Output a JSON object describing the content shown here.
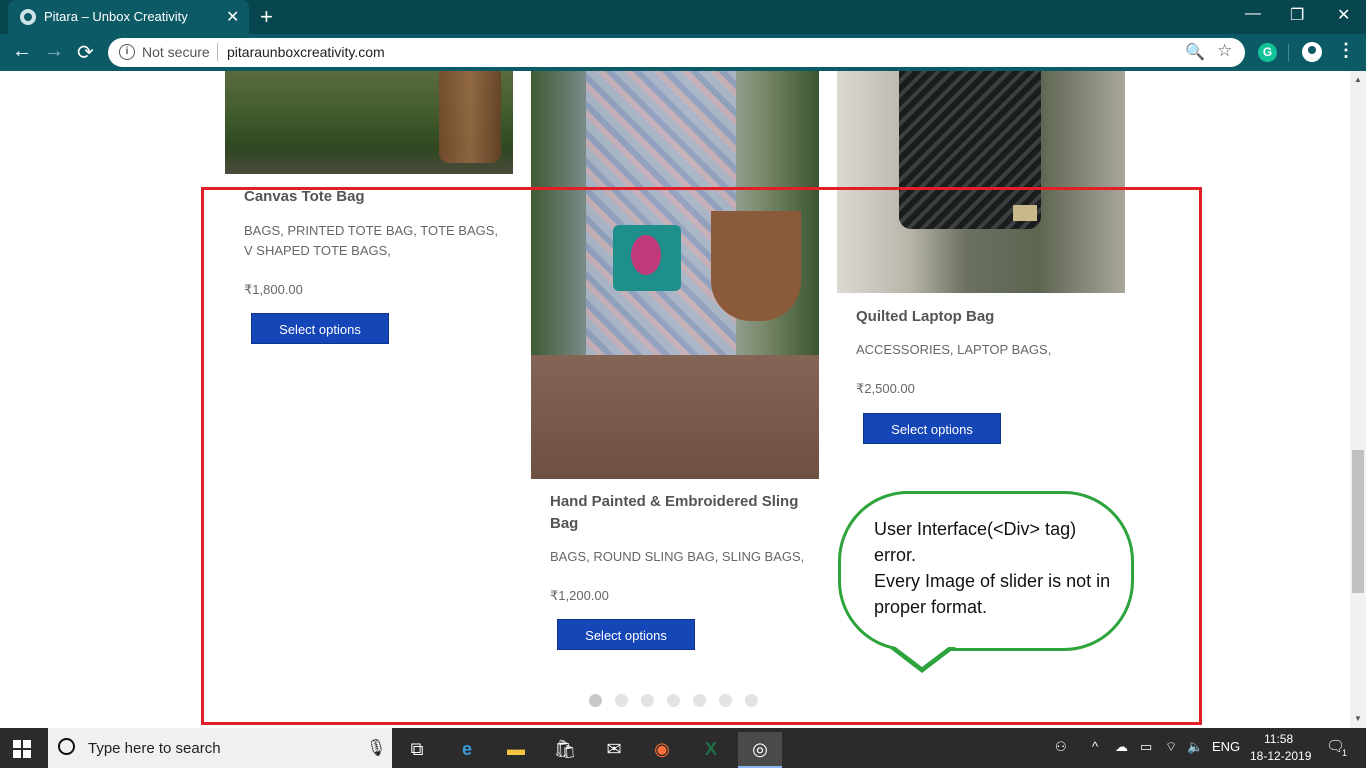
{
  "browser": {
    "tab_title": "Pitara – Unbox Creativity",
    "tab_close": "✕",
    "new_tab": "+",
    "window_controls": {
      "minimize": "—",
      "restore": "❐",
      "close": "✕"
    },
    "nav": {
      "back": "←",
      "forward": "→",
      "reload": "⟳"
    },
    "security_label": "Not secure",
    "url": "pitaraunboxcreativity.com",
    "icons": {
      "zoom": "🔍",
      "star": "☆",
      "extension_letter": "G",
      "menu": "⋮"
    }
  },
  "products": [
    {
      "title": "Canvas Tote Bag",
      "categories": "BAGS, PRINTED TOTE BAG, TOTE BAGS, V SHAPED TOTE BAGS,",
      "price": "₹1,800.00",
      "button": "Select options"
    },
    {
      "title": "Hand Painted & Embroidered Sling Bag",
      "categories": "BAGS, ROUND SLING BAG, SLING BAGS,",
      "price": "₹1,200.00",
      "button": "Select options"
    },
    {
      "title": "Quilted Laptop Bag",
      "categories": "ACCESSORIES, LAPTOP BAGS,",
      "price": "₹2,500.00",
      "button": "Select options"
    }
  ],
  "slider": {
    "dot_count": 7,
    "active_dot": 1
  },
  "annotation": {
    "line1": "User Interface(<Div> tag) error.",
    "line2": "Every Image of slider is not in proper format.",
    "box_color": "#e21f26",
    "callout_color": "#2ca33b"
  },
  "taskbar": {
    "search_placeholder": "Type here to search",
    "language": "ENG",
    "time": "11:58",
    "date": "18-12-2019",
    "tray_icons": {
      "people": "⚇",
      "chevron": "^",
      "cloud": "☁",
      "battery": "▭",
      "wifi": "⌔",
      "volume": "🔈",
      "notification": "🗨",
      "notification_count": "1"
    }
  },
  "colors": {
    "brand_teal": "#0b5a66",
    "button_blue": "#1546b8"
  }
}
